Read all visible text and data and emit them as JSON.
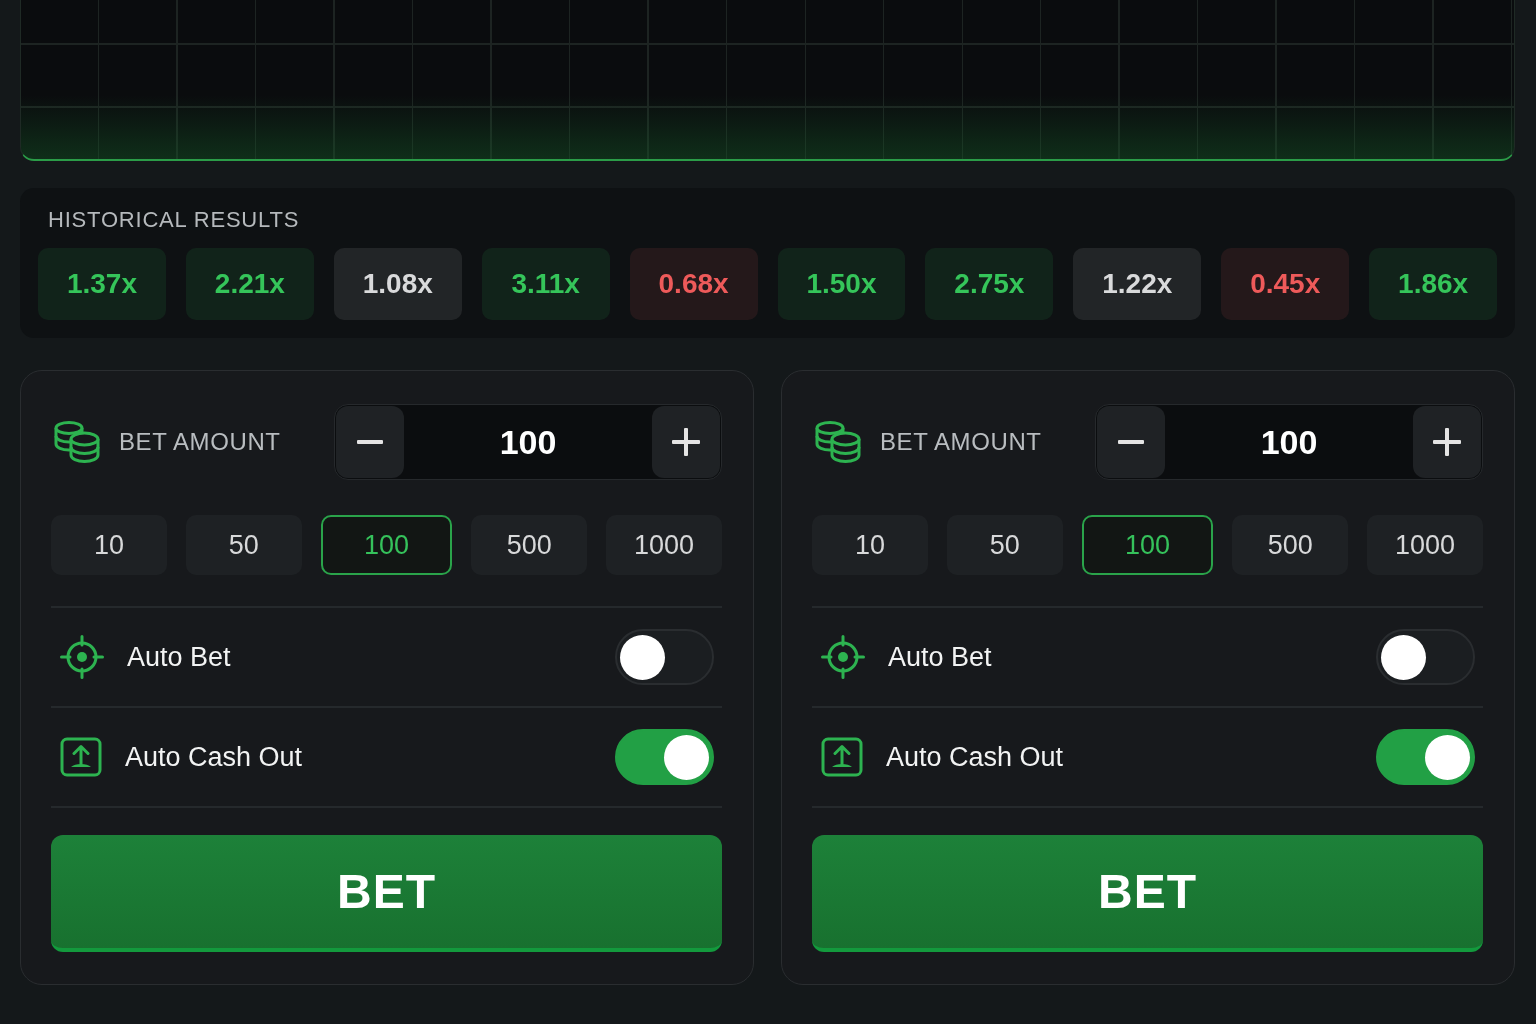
{
  "history": {
    "title": "HISTORICAL RESULTS",
    "results": [
      {
        "value": "1.37x",
        "color": "#35c55a"
      },
      {
        "value": "2.21x",
        "color": "#35c55a"
      },
      {
        "value": "1.08x",
        "color": "#d9dadb"
      },
      {
        "value": "3.11x",
        "color": "#35c55a"
      },
      {
        "value": "0.68x",
        "color": "#ee5a5a"
      },
      {
        "value": "1.50x",
        "color": "#35c55a"
      },
      {
        "value": "2.75x",
        "color": "#35c55a"
      },
      {
        "value": "1.22x",
        "color": "#d9dadb"
      },
      {
        "value": "0.45x",
        "color": "#ee5a5a"
      },
      {
        "value": "1.86x",
        "color": "#35c55a"
      }
    ]
  },
  "bet_panels": [
    {
      "title": "BET AMOUNT",
      "amount": "100",
      "presets": [
        {
          "label": "10",
          "selected": false
        },
        {
          "label": "50",
          "selected": false
        },
        {
          "label": "100",
          "selected": true
        },
        {
          "label": "500",
          "selected": false
        },
        {
          "label": "1000",
          "selected": false
        }
      ],
      "options": [
        {
          "label": "Auto Bet",
          "on": false
        },
        {
          "label": "Auto Cash Out",
          "on": true
        }
      ],
      "button": "BET"
    },
    {
      "title": "BET AMOUNT",
      "amount": "100",
      "presets": [
        {
          "label": "10",
          "selected": false
        },
        {
          "label": "50",
          "selected": false
        },
        {
          "label": "100",
          "selected": true
        },
        {
          "label": "500",
          "selected": false
        },
        {
          "label": "1000",
          "selected": false
        }
      ],
      "options": [
        {
          "label": "Auto Bet",
          "on": false
        },
        {
          "label": "Auto Cash Out",
          "on": true
        }
      ],
      "button": "BET"
    }
  ]
}
